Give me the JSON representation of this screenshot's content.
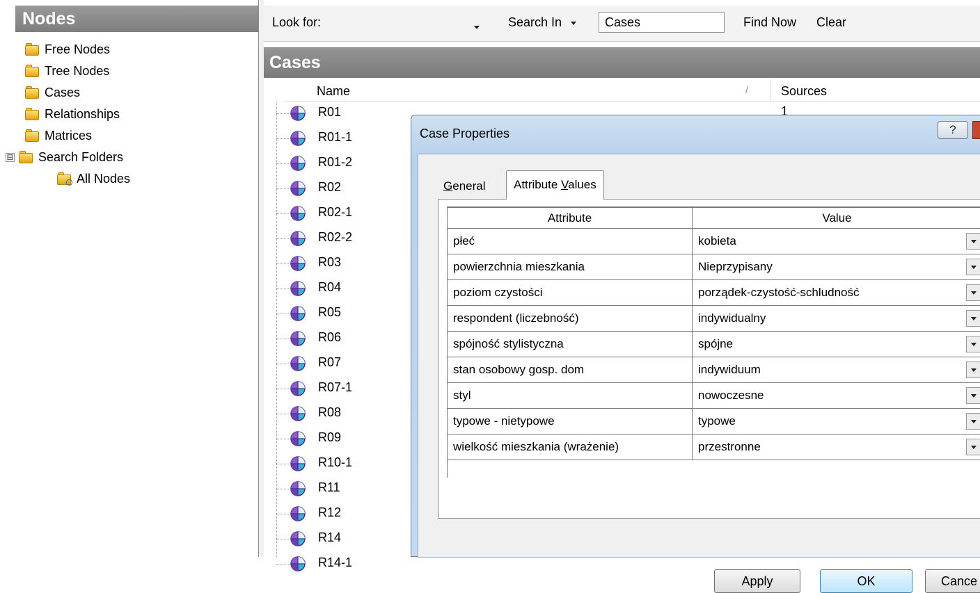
{
  "nav": {
    "title": "Nodes",
    "items": [
      {
        "label": "Free Nodes",
        "icon": "folder-icon"
      },
      {
        "label": "Tree Nodes",
        "icon": "folder-icon"
      },
      {
        "label": "Cases",
        "icon": "folder-icon"
      },
      {
        "label": "Relationships",
        "icon": "folder-icon"
      },
      {
        "label": "Matrices",
        "icon": "folder-icon"
      },
      {
        "label": "Search Folders",
        "icon": "folder-open-icon",
        "expander": "⊟"
      },
      {
        "label": "All Nodes",
        "icon": "search-folder-icon"
      }
    ]
  },
  "search": {
    "look_for_label": "Look for:",
    "look_for_value": "",
    "search_in_label": "Search In",
    "search_in_value": "Cases",
    "find_now_label": "Find Now",
    "clear_label": "Clear"
  },
  "cases": {
    "title": "Cases",
    "columns": {
      "name": "Name",
      "sort_marker": "/",
      "sources": "Sources"
    },
    "first_row_sources": "1",
    "rows": [
      "R01",
      "R01-1",
      "R01-2",
      "R02",
      "R02-1",
      "R02-2",
      "R03",
      "R04",
      "R05",
      "R06",
      "R07",
      "R07-1",
      "R08",
      "R09",
      "R10-1",
      "R11",
      "R12",
      "R14",
      "R14-1"
    ]
  },
  "dialog": {
    "title": "Case Properties",
    "help": "?",
    "tabs": {
      "general": {
        "pre": "",
        "mnemonic": "G",
        "post": "eneral"
      },
      "attr": {
        "pre": "Attribute ",
        "mnemonic": "V",
        "post": "alues"
      }
    },
    "grid": {
      "headers": {
        "attribute": "Attribute",
        "value": "Value"
      },
      "rows": [
        {
          "attribute": "płeć",
          "value": "kobieta"
        },
        {
          "attribute": "powierzchnia mieszkania",
          "value": "Nieprzypisany"
        },
        {
          "attribute": "poziom czystości",
          "value": "porządek-czystość-schludność"
        },
        {
          "attribute": "respondent (liczebność)",
          "value": "indywidualny"
        },
        {
          "attribute": "spójność stylistyczna",
          "value": "spójne"
        },
        {
          "attribute": "stan osobowy gosp. dom",
          "value": "indywiduum"
        },
        {
          "attribute": "styl",
          "value": "nowoczesne"
        },
        {
          "attribute": "typowe - nietypowe",
          "value": "typowe"
        },
        {
          "attribute": "wielkość mieszkania (wrażenie)",
          "value": "przestronne"
        }
      ]
    },
    "buttons": {
      "apply": "Apply",
      "ok": "OK",
      "cancel": "Cance"
    }
  },
  "colors": {
    "header_gray": "#8a8a8a",
    "dialog_frame": "#b9d1ea",
    "case_icon_purple": "#6c3fb0",
    "case_icon_cyan": "#36b6d8"
  }
}
